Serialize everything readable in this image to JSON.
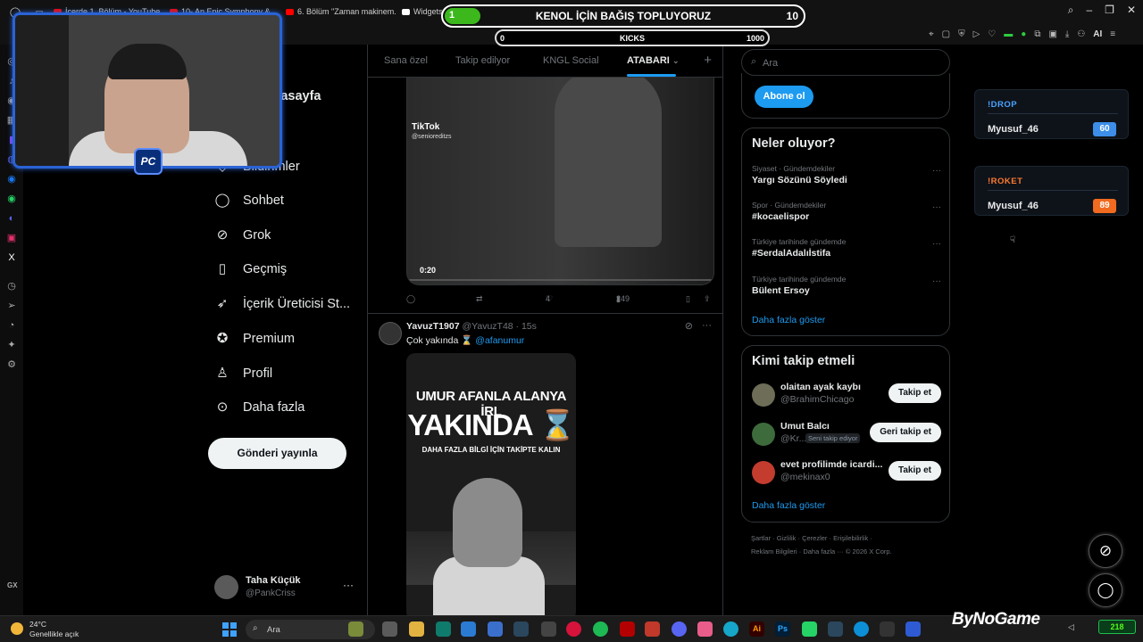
{
  "browser": {
    "tabs": [
      {
        "label": "İçerde 1. Bölüm - YouTube",
        "icon": "youtube-icon"
      },
      {
        "label": "10- An Epic Symphony & ...",
        "icon": "youtube-icon"
      },
      {
        "label": "6. Bölüm \"Zaman makinem...",
        "icon": "youtube-icon"
      },
      {
        "label": "Widgets |",
        "icon": "widgets-icon"
      },
      {
        "label": "...",
        "icon": "x-icon"
      }
    ]
  },
  "overlay": {
    "donation_title": "KENOL İÇİN BAĞIŞ TOPLUYORUZ",
    "donation_current": "1",
    "donation_goal": "10",
    "donation_progress": 0.1,
    "kicks_label": "KICKS",
    "kicks_min": "0",
    "kicks_max": "1000",
    "webcam_badge": "PC"
  },
  "nav": {
    "home_label": "Anasayfa",
    "items": [
      {
        "label": "Bildirimler",
        "icon": "bell-icon"
      },
      {
        "label": "Sohbet",
        "icon": "chat-icon"
      },
      {
        "label": "Grok",
        "icon": "grok-icon"
      },
      {
        "label": "Geçmiş",
        "icon": "bookmark-icon"
      },
      {
        "label": "İçerik Üreticisi St...",
        "icon": "rocket-icon"
      },
      {
        "label": "Premium",
        "icon": "verified-icon"
      },
      {
        "label": "Profil",
        "icon": "profile-icon"
      },
      {
        "label": "Daha fazla",
        "icon": "more-icon"
      }
    ],
    "post_button": "Gönderi yayınla",
    "user_name": "Taha Küçük",
    "user_handle": "@PankCriss"
  },
  "timeline": {
    "tabs": [
      "Sana özel",
      "Takip edilyor",
      "KNGL Social",
      "ATABARI"
    ],
    "active_tab": "ATABARI",
    "tweet1": {
      "tiktok_label": "TikTok",
      "tiktok_handle": "@senioreditzs",
      "video_time": "0:20",
      "likes": "4",
      "views": "249"
    },
    "tweet2": {
      "name": "YavuzT1907",
      "handle": "@YavuzT48",
      "time": "· 15s",
      "text": "Çok yakında ⌛",
      "mention": "@afanumur",
      "poster_line1": "UMUR AFANLA ALANYA İRL",
      "poster_line2": "YAKINDA ⌛",
      "poster_line3": "DAHA FAZLA BİLGİ İÇİN TAKİPTE KALIN"
    }
  },
  "sidebar": {
    "search_placeholder": "Ara",
    "subscribe_button": "Abone ol",
    "trends_title": "Neler oluyor?",
    "trends": [
      {
        "category": "Siyaset · Gündemdekiler",
        "title": "Yargı Sözünü Söyledi"
      },
      {
        "category": "Spor · Gündemdekiler",
        "title": "#kocaelispor"
      },
      {
        "category": "Türkiye tarihinde gündemde",
        "title": "#SerdalAdalıİstifa"
      },
      {
        "category": "Türkiye tarihinde gündemde",
        "title": "Bülent Ersoy"
      }
    ],
    "show_more": "Daha fazla göster",
    "who_title": "Kimi takip etmeli",
    "who": [
      {
        "name": "olaitan ayak kaybı",
        "handle": "@BrahimChicago",
        "button": "Takip et",
        "follows_you": ""
      },
      {
        "name": "Umut Balcı",
        "handle": "@Kr...",
        "button": "Geri takip et",
        "follows_you": "Seni takip ediyor"
      },
      {
        "name": "evet profilimde icardi...",
        "handle": "@mekinax0",
        "button": "Takip et",
        "follows_you": ""
      }
    ],
    "who_show_more": "Daha fazla göster",
    "footer_line1": "Şartlar · Gizlilik · Çerezler · Erişilebilirlik ·",
    "footer_line2": "Reklam Bilgileri · Daha fazla ··· © 2026 X Corp."
  },
  "widgets": {
    "drop_label": "!DROP",
    "drop_user": "Myusuf_46",
    "drop_value": "60",
    "roket_label": "!ROKET",
    "roket_user": "Myusuf_46",
    "roket_value": "89",
    "drop_color": "#4aa3ff",
    "roket_color": "#ff7a2f"
  },
  "taskbar": {
    "temperature": "24°C",
    "condition": "Genellikle açık",
    "search_label": "Ara",
    "brand": "ByNoGame",
    "kick_badge": "218"
  },
  "extbar": {
    "ai_label": "AI"
  },
  "opera": {
    "gx_label": "GX"
  }
}
